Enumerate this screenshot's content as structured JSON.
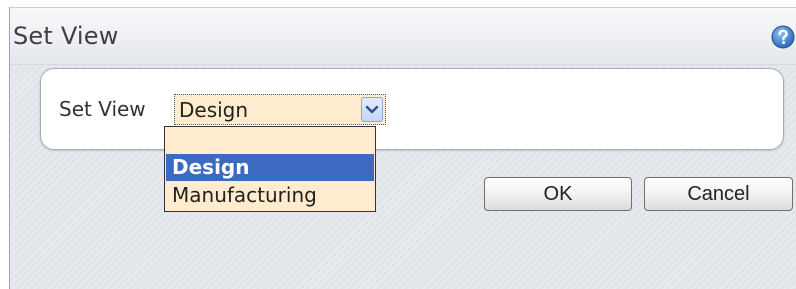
{
  "dialog": {
    "title": "Set View",
    "help_icon": "help-question-icon"
  },
  "form": {
    "label": "Set View",
    "selected_value": "Design",
    "dropdown_arrow_icon": "chevron-down-icon",
    "options": [
      "",
      "Design",
      "Manufacturing"
    ],
    "highlighted_option": "Design"
  },
  "buttons": {
    "ok_label": "OK",
    "cancel_label": "Cancel"
  },
  "colors": {
    "select_background": "#ffebcd",
    "highlight": "#3c6ac2",
    "help_icon": "#3a78c8"
  }
}
